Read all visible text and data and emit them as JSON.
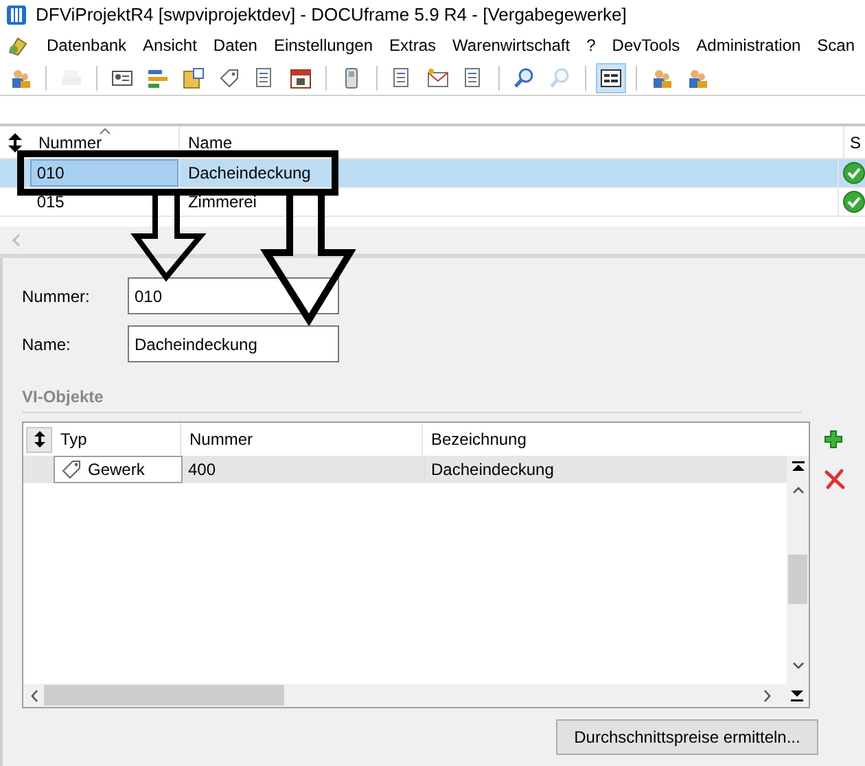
{
  "window": {
    "title": "DFViProjektR4 [swpviprojektdev] - DOCUframe 5.9 R4 - [Vergabegewerke]"
  },
  "menu": [
    "Datenbank",
    "Ansicht",
    "Daten",
    "Einstellungen",
    "Extras",
    "Warenwirtschaft",
    "?",
    "DevTools",
    "Administration",
    "Scan"
  ],
  "toolbar": [
    {
      "kind": "people",
      "selected": false
    },
    {
      "kind": "separator"
    },
    {
      "kind": "printer",
      "selected": false,
      "disabled": true
    },
    {
      "kind": "separator"
    },
    {
      "kind": "card",
      "selected": false
    },
    {
      "kind": "bars",
      "selected": false
    },
    {
      "kind": "folder",
      "selected": false
    },
    {
      "kind": "tag",
      "selected": false
    },
    {
      "kind": "document",
      "selected": false
    },
    {
      "kind": "calendar",
      "selected": false
    },
    {
      "kind": "separator"
    },
    {
      "kind": "phone",
      "selected": false
    },
    {
      "kind": "separator"
    },
    {
      "kind": "document",
      "selected": false
    },
    {
      "kind": "mail",
      "selected": false
    },
    {
      "kind": "document",
      "selected": false
    },
    {
      "kind": "separator"
    },
    {
      "kind": "search",
      "selected": false
    },
    {
      "kind": "search",
      "selected": false,
      "disabled": true
    },
    {
      "kind": "separator"
    },
    {
      "kind": "form",
      "selected": true
    },
    {
      "kind": "separator"
    },
    {
      "kind": "people",
      "selected": false
    },
    {
      "kind": "people",
      "selected": false
    }
  ],
  "table": {
    "columns": [
      "Nummer",
      "Name",
      "S"
    ],
    "rows": [
      {
        "nummer": "010",
        "name": "Dacheindeckung",
        "selected": true
      },
      {
        "nummer": "015",
        "name": "Zimmerei",
        "selected": false
      }
    ]
  },
  "details": {
    "fields": [
      {
        "label": "Nummer:",
        "value": "010"
      },
      {
        "label": "Name:",
        "value": "Dacheindeckung"
      }
    ],
    "section": "VI-Objekte",
    "objects": {
      "columns": [
        "Typ",
        "Nummer",
        "Bezeichnung"
      ],
      "rows": [
        {
          "typ": "Gewerk",
          "nummer": "400",
          "bezeichnung": "Dacheindeckung",
          "selected": true
        }
      ]
    },
    "button": "Durchschnittspreise ermitteln..."
  }
}
